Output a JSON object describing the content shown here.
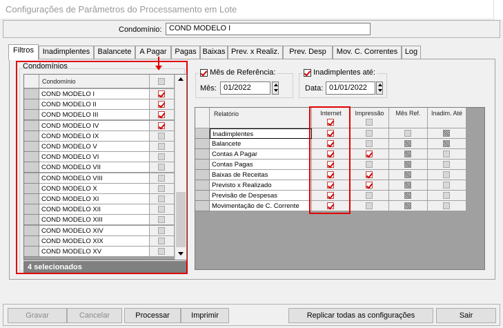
{
  "window": {
    "title": "Configurações de Parâmetros do Processamento em Lote"
  },
  "condominio": {
    "label": "Condomínio:",
    "value": "COND MODELO I"
  },
  "tabs": [
    "Filtros",
    "Inadimplentes",
    "Balancete",
    "A Pagar",
    "Pagas",
    "Baixas",
    "Prev. x Realiz.",
    "Prev. Desp",
    "Mov. C. Correntes",
    "Log"
  ],
  "active_tab": "Filtros",
  "condominios_group": {
    "title": "Condomínios",
    "column_header": "Condomínio",
    "rows": [
      {
        "name": "COND MODELO I",
        "checked": true
      },
      {
        "name": "COND MODELO II",
        "checked": true
      },
      {
        "name": "COND MODELO III",
        "checked": true
      },
      {
        "name": "COND MODELO IV",
        "checked": true
      },
      {
        "name": "COND MODELO IX",
        "checked": false
      },
      {
        "name": "COND MODELO V",
        "checked": false
      },
      {
        "name": "COND MODELO VI",
        "checked": false
      },
      {
        "name": "COND MODELO VII",
        "checked": false
      },
      {
        "name": "COND MODELO VIII",
        "checked": false
      },
      {
        "name": "COND MODELO X",
        "checked": false
      },
      {
        "name": "COND MODELO XI",
        "checked": false
      },
      {
        "name": "COND MODELO XII",
        "checked": false
      },
      {
        "name": "COND MODELO XIII",
        "checked": false
      },
      {
        "name": "COND MODELO XIV",
        "checked": false
      },
      {
        "name": "COND MODELO XIX",
        "checked": false
      },
      {
        "name": "COND MODELO XV",
        "checked": false
      }
    ],
    "footer": "4 selecionados"
  },
  "mes_referencia": {
    "checkbox_label": "Mês de Referência:",
    "checked": true,
    "field_label": "Mês:",
    "value": "01/2022"
  },
  "inadimplentes_ate": {
    "checkbox_label": "Inadimplentes até:",
    "checked": true,
    "field_label": "Data:",
    "value": "01/01/2022"
  },
  "relatorios": {
    "headers": {
      "relatorio": "Relatório",
      "internet": "Internet",
      "impressao": "Impressão",
      "mes_ref": "Mês Ref.",
      "inadim_ate": "Inadim. Até"
    },
    "header_checks": {
      "internet": true,
      "impressao": false
    },
    "rows": [
      {
        "name": "Inadimplentes",
        "internet": true,
        "impressao": false,
        "mes_ref": "off",
        "inadim": "hatch"
      },
      {
        "name": "Balancete",
        "internet": true,
        "impressao": false,
        "mes_ref": "hatch",
        "inadim": "hatch"
      },
      {
        "name": "Contas A Pagar",
        "internet": true,
        "impressao": true,
        "mes_ref": "hatch",
        "inadim": "off"
      },
      {
        "name": "Contas Pagas",
        "internet": true,
        "impressao": false,
        "mes_ref": "hatch",
        "inadim": "off"
      },
      {
        "name": "Baixas de Receitas",
        "internet": true,
        "impressao": true,
        "mes_ref": "hatch",
        "inadim": "off"
      },
      {
        "name": "Previsto x Realizado",
        "internet": true,
        "impressao": true,
        "mes_ref": "hatch",
        "inadim": "off"
      },
      {
        "name": "Previsão de Despesas",
        "internet": true,
        "impressao": false,
        "mes_ref": "hatch",
        "inadim": "off"
      },
      {
        "name": "Movimentação de C. Corrente",
        "internet": true,
        "impressao": false,
        "mes_ref": "hatch",
        "inadim": "off"
      }
    ]
  },
  "buttons": {
    "gravar": "Gravar",
    "cancelar": "Cancelar",
    "processar": "Processar",
    "imprimir": "Imprimir",
    "replicar": "Replicar todas as configurações",
    "sair": "Sair"
  },
  "colors": {
    "highlight": "#e00000",
    "check": "#d00000"
  }
}
